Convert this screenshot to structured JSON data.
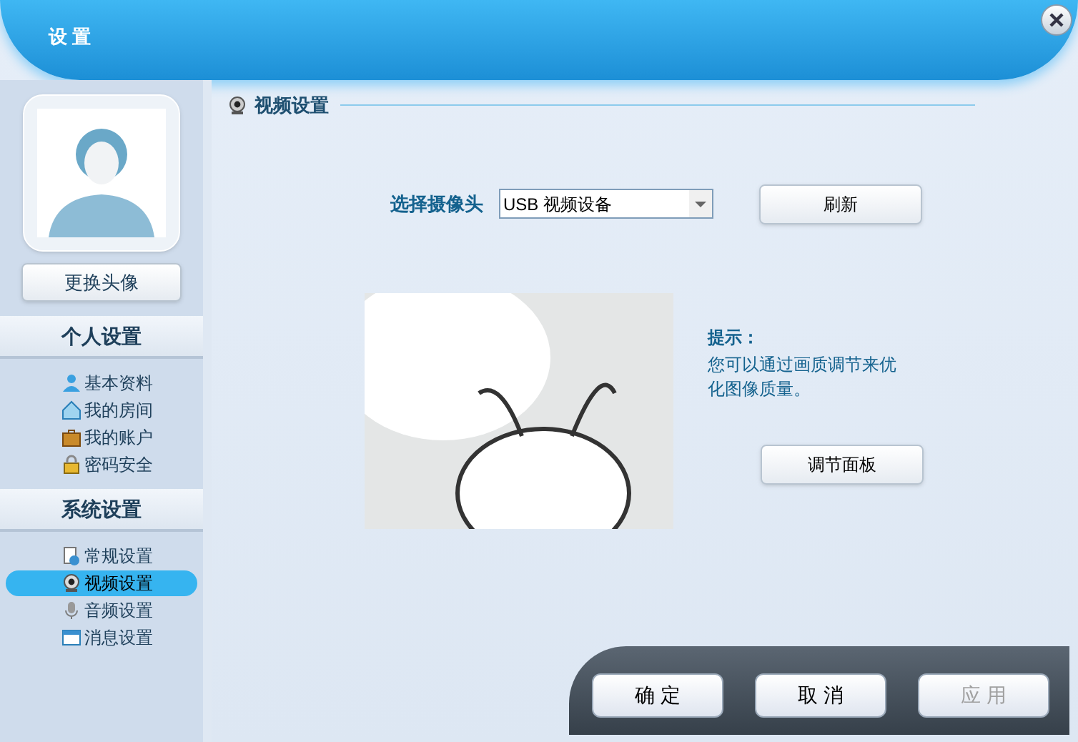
{
  "window": {
    "title": "设 置"
  },
  "profile": {
    "change_avatar_button": "更换头像"
  },
  "sidebar": {
    "sections": [
      {
        "title": "个人设置",
        "items": [
          {
            "label": "基本资料",
            "kind": "person",
            "selected": false
          },
          {
            "label": "我的房间",
            "kind": "house",
            "selected": false
          },
          {
            "label": "我的账户",
            "kind": "briefcase",
            "selected": false
          },
          {
            "label": "密码安全",
            "kind": "lock",
            "selected": false
          }
        ]
      },
      {
        "title": "系统设置",
        "items": [
          {
            "label": "常规设置",
            "kind": "gear",
            "selected": false
          },
          {
            "label": "视频设置",
            "kind": "webcam",
            "selected": true
          },
          {
            "label": "音频设置",
            "kind": "mic",
            "selected": false
          },
          {
            "label": "消息设置",
            "kind": "window",
            "selected": false
          }
        ]
      }
    ]
  },
  "content": {
    "heading": "视频设置",
    "camera_label": "选择摄像头",
    "camera_select": {
      "value": "USB 视频设备"
    },
    "refresh_button": "刷新",
    "tip_title": "提示：",
    "tip_text": "您可以通过画质调节来优化图像质量。",
    "adjust_button": "调节面板"
  },
  "footer_buttons": [
    {
      "label": "确 定",
      "disabled": false
    },
    {
      "label": "取 消",
      "disabled": false
    },
    {
      "label": "应 用",
      "disabled": true
    }
  ]
}
